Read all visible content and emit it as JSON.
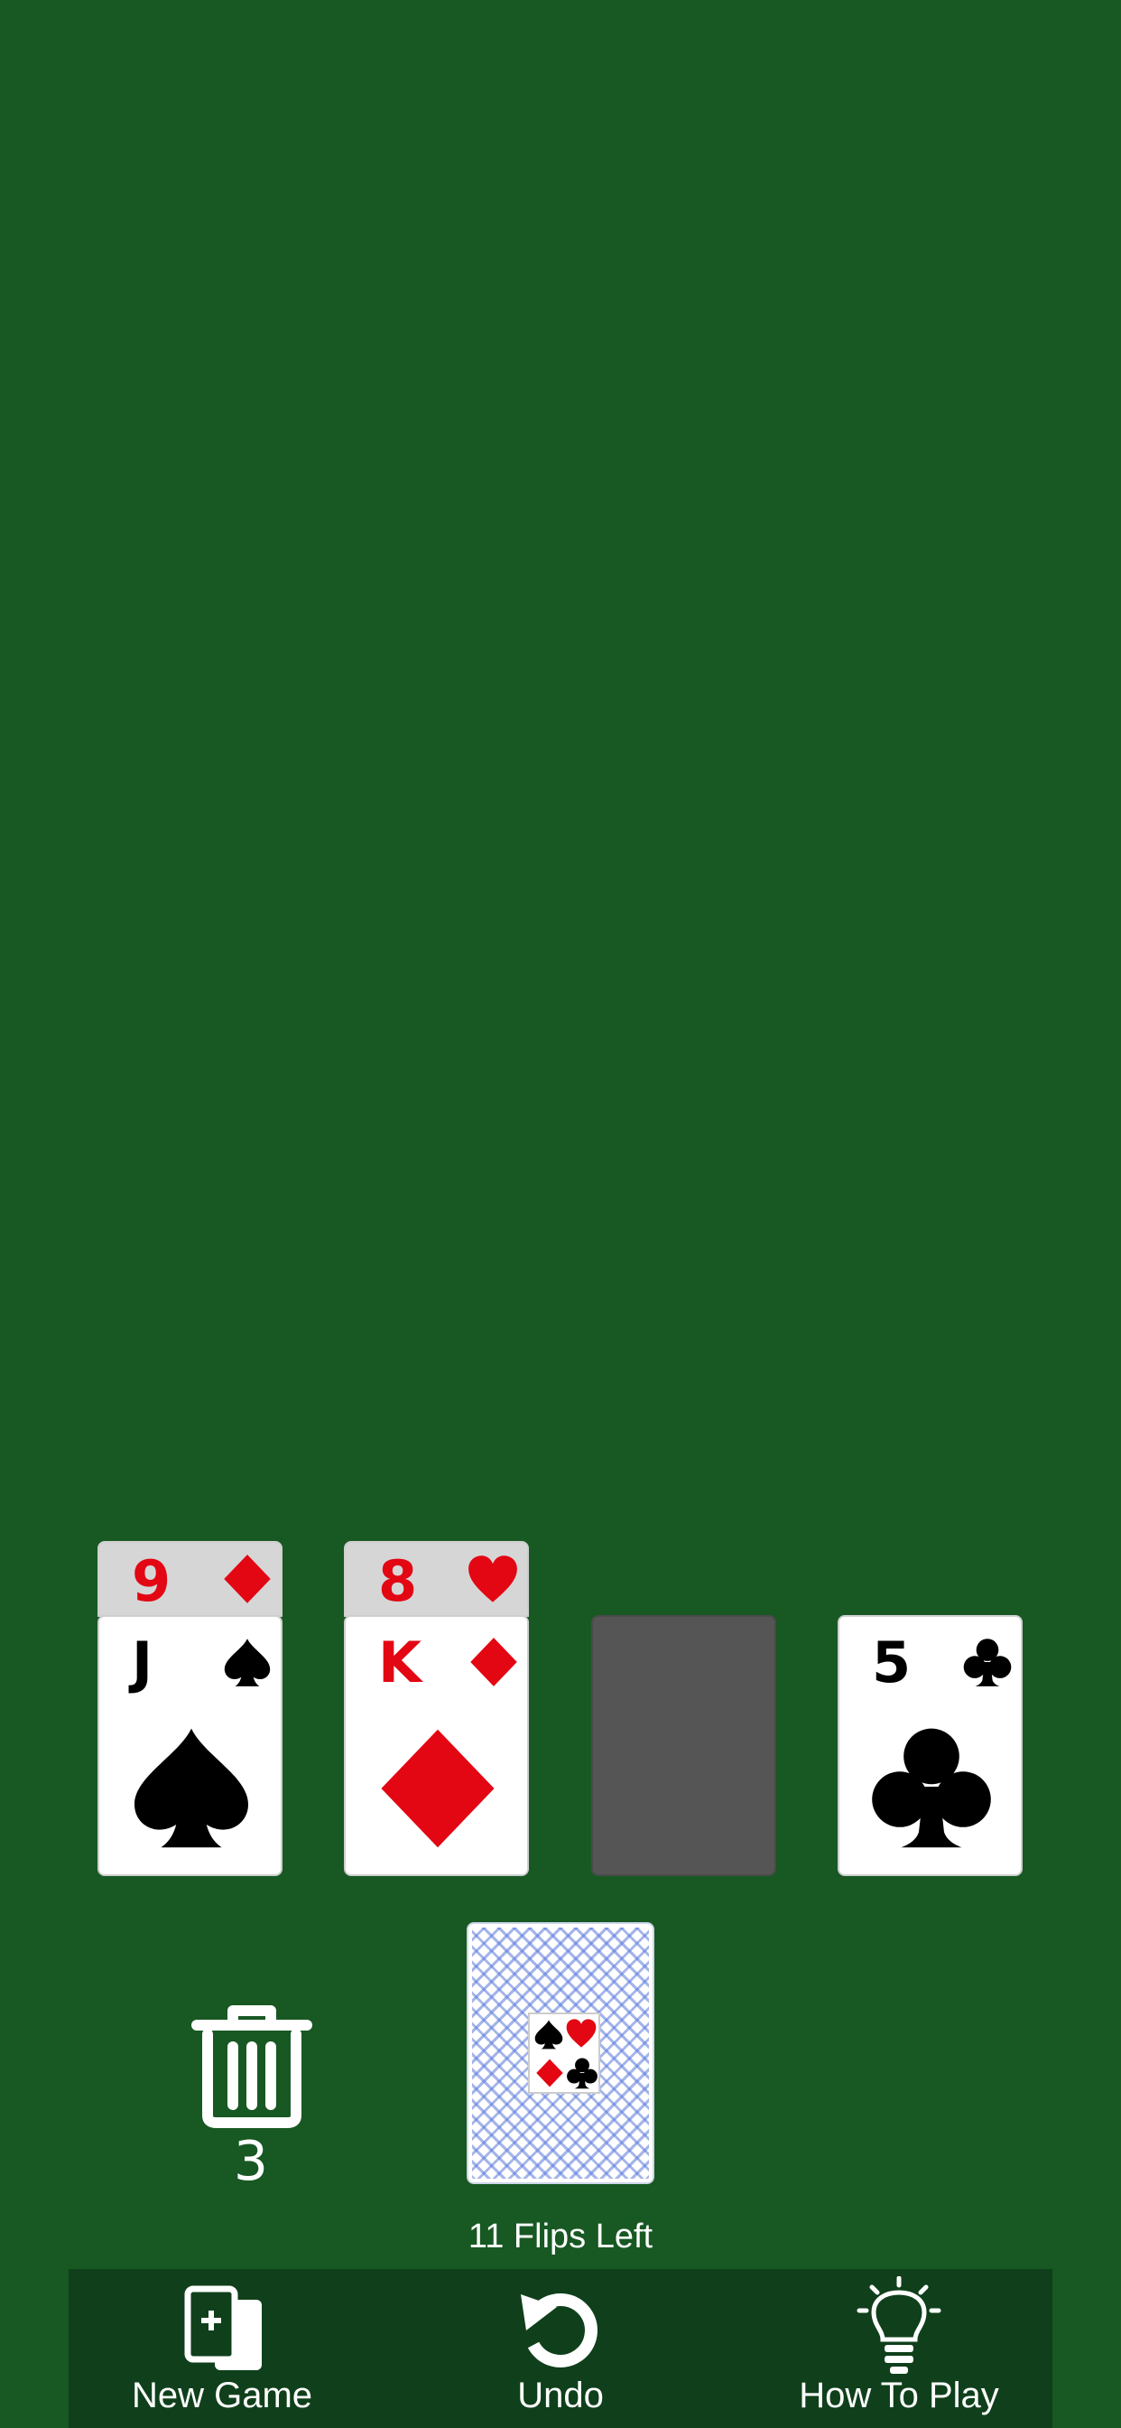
{
  "tableau": {
    "pile1": {
      "under_card": {
        "rank": "9",
        "suit": "diamond",
        "color": "#e30613"
      },
      "top_card": {
        "rank": "J",
        "suit": "spade",
        "color": "#000000"
      }
    },
    "pile2": {
      "under_card": {
        "rank": "8",
        "suit": "heart",
        "color": "#e30613"
      },
      "top_card": {
        "rank": "K",
        "suit": "diamond",
        "color": "#e30613"
      }
    },
    "pile3": {
      "state": "empty"
    },
    "pile4": {
      "top_card": {
        "rank": "5",
        "suit": "club",
        "color": "#000000"
      }
    }
  },
  "discard": {
    "icon": "trash-icon",
    "count": "3"
  },
  "deck": {
    "icon": "card-back",
    "flips_label": "11 Flips Left"
  },
  "toolbar": {
    "new_game_label": "New Game",
    "undo_label": "Undo",
    "how_to_play_label": "How To Play"
  },
  "colors": {
    "felt": "#185823",
    "toolbar": "#0f401b",
    "red_suit": "#e30613",
    "empty_slot": "#555555"
  }
}
